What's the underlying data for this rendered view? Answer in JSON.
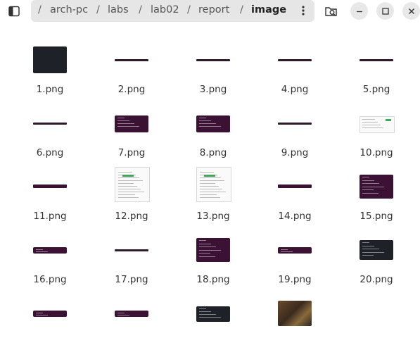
{
  "path": [
    "arch-pc",
    "labs",
    "lab02",
    "report",
    "image"
  ],
  "header": {
    "sidebar_icon": "sidebar-icon",
    "menu_icon": "kebab-menu-icon",
    "search_icon": "folder-search-icon",
    "minimize_icon": "minimize-icon",
    "maximize_icon": "maximize-icon",
    "close_icon": "close-icon"
  },
  "files": [
    {
      "name": "1.png",
      "thumb": "dark-window"
    },
    {
      "name": "2.png",
      "thumb": "line"
    },
    {
      "name": "3.png",
      "thumb": "line"
    },
    {
      "name": "4.png",
      "thumb": "line"
    },
    {
      "name": "5.png",
      "thumb": "line"
    },
    {
      "name": "6.png",
      "thumb": "line"
    },
    {
      "name": "7.png",
      "thumb": "terminal"
    },
    {
      "name": "8.png",
      "thumb": "terminal"
    },
    {
      "name": "9.png",
      "thumb": "line"
    },
    {
      "name": "10.png",
      "thumb": "web-wide"
    },
    {
      "name": "11.png",
      "thumb": "line-thick"
    },
    {
      "name": "12.png",
      "thumb": "web"
    },
    {
      "name": "13.png",
      "thumb": "web"
    },
    {
      "name": "14.png",
      "thumb": "line-thick"
    },
    {
      "name": "15.png",
      "thumb": "terminal-tall"
    },
    {
      "name": "16.png",
      "thumb": "strip"
    },
    {
      "name": "17.png",
      "thumb": "line"
    },
    {
      "name": "18.png",
      "thumb": "terminal-tall"
    },
    {
      "name": "19.png",
      "thumb": "strip"
    },
    {
      "name": "20.png",
      "thumb": "dark-tall"
    },
    {
      "name": "",
      "thumb": "strip"
    },
    {
      "name": "",
      "thumb": "strip"
    },
    {
      "name": "",
      "thumb": "dark-strip"
    },
    {
      "name": "",
      "thumb": "photo"
    }
  ],
  "colors": {
    "pathbar_bg": "#e6e6e6",
    "terminal_purple": "#3b1233",
    "dark_panel": "#1e2228",
    "accent_green": "#3da85a"
  }
}
